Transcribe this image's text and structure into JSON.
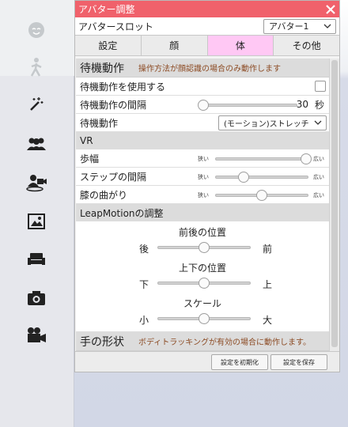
{
  "window": {
    "title": "アバター調整"
  },
  "slot": {
    "label": "アバタースロット",
    "selected": "アバター1"
  },
  "tabs": [
    {
      "label": "設定",
      "active": false
    },
    {
      "label": "顔",
      "active": false
    },
    {
      "label": "体",
      "active": true
    },
    {
      "label": "その他",
      "active": false
    }
  ],
  "idle": {
    "title": "待機動作",
    "note": "操作方法が顔認識の場合のみ動作します",
    "use_label": "待機動作を使用する",
    "use_checked": false,
    "interval_label": "待機動作の間隔",
    "interval_value": "30",
    "interval_unit": "秒",
    "interval_fraction": 0.0,
    "motion_label": "待機動作",
    "motion_selected": "(モーション)ストレッチ"
  },
  "vr": {
    "title": "VR",
    "stride_label": "歩幅",
    "stride_fraction": 0.98,
    "step_label": "ステップの間隔",
    "step_fraction": 0.3,
    "knee_label": "膝の曲がり",
    "knee_fraction": 0.5,
    "min_label": "狭い",
    "max_label": "広い"
  },
  "leap": {
    "title": "LeapMotionの調整",
    "fb_title": "前後の位置",
    "fb_min": "後",
    "fb_max": "前",
    "fb_fraction": 0.5,
    "ud_title": "上下の位置",
    "ud_min": "下",
    "ud_max": "上",
    "ud_fraction": 0.5,
    "scale_title": "スケール",
    "scale_min": "小",
    "scale_max": "大",
    "scale_fraction": 0.5
  },
  "hand": {
    "title": "手の形状",
    "note": "ボディトラッキングが有効の場合に動作します。"
  },
  "buttons": {
    "reset": "設定を初期化",
    "save": "設定を保存"
  },
  "colors": {
    "titlebar": "#f0616b",
    "active_tab": "#ffc8f4",
    "note": "#8c4b24"
  },
  "sidebar_icons": [
    "face-icon",
    "walking-figure-icon",
    "magic-wand-icon",
    "group-icon",
    "video-person-icon",
    "image-icon",
    "sofa-icon",
    "camera-icon",
    "video-camera-icon"
  ]
}
